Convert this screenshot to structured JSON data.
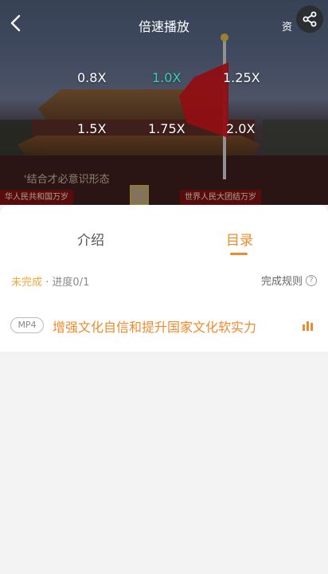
{
  "header": {
    "title": "倍速播放",
    "resource_label": "资",
    "back_icon": "chevron-left-icon",
    "share_icon": "share-icon"
  },
  "speed_options": {
    "row1": [
      "0.8X",
      "1.0X",
      "1.25X"
    ],
    "row2": [
      "1.5X",
      "1.75X",
      "2.0X"
    ],
    "selected": "1.0X",
    "selected_color": "#3dcfb6"
  },
  "video_overlay": {
    "subtitle_fragment": "'结合才必意识形态",
    "banner_left": "华人民共和国万岁",
    "banner_right": "世界人民大团结万岁"
  },
  "tabs": [
    {
      "label": "介绍",
      "active": false
    },
    {
      "label": "目录",
      "active": true
    }
  ],
  "status": {
    "state": "未完成",
    "separator": " · ",
    "progress": "进度0/1",
    "rules_label": "完成规则",
    "rules_icon": "?"
  },
  "lessons": [
    {
      "format": "MP4",
      "title": "增强文化自信和提升国家文化软实力",
      "playing": true
    }
  ],
  "colors": {
    "accent": "#f08a2c",
    "incomplete": "#f2a63a",
    "speed_active": "#3dcfb6"
  }
}
